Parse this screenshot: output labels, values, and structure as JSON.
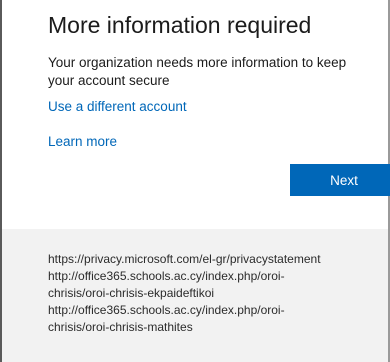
{
  "dialog": {
    "title": "More information required",
    "description": "Your organization needs more information to keep your account secure",
    "use_different_account": "Use a different account",
    "learn_more": "Learn more",
    "next_label": "Next",
    "accent_color": "#0067b8"
  },
  "footer": {
    "lines": [
      "https://privacy.microsoft.com/el-gr/privacystatement",
      "http://office365.schools.ac.cy/index.php/oroi-",
      "chrisis/oroi-chrisis-ekpaideftikoi",
      "http://office365.schools.ac.cy/index.php/oroi-",
      "chrisis/oroi-chrisis-mathites"
    ]
  }
}
